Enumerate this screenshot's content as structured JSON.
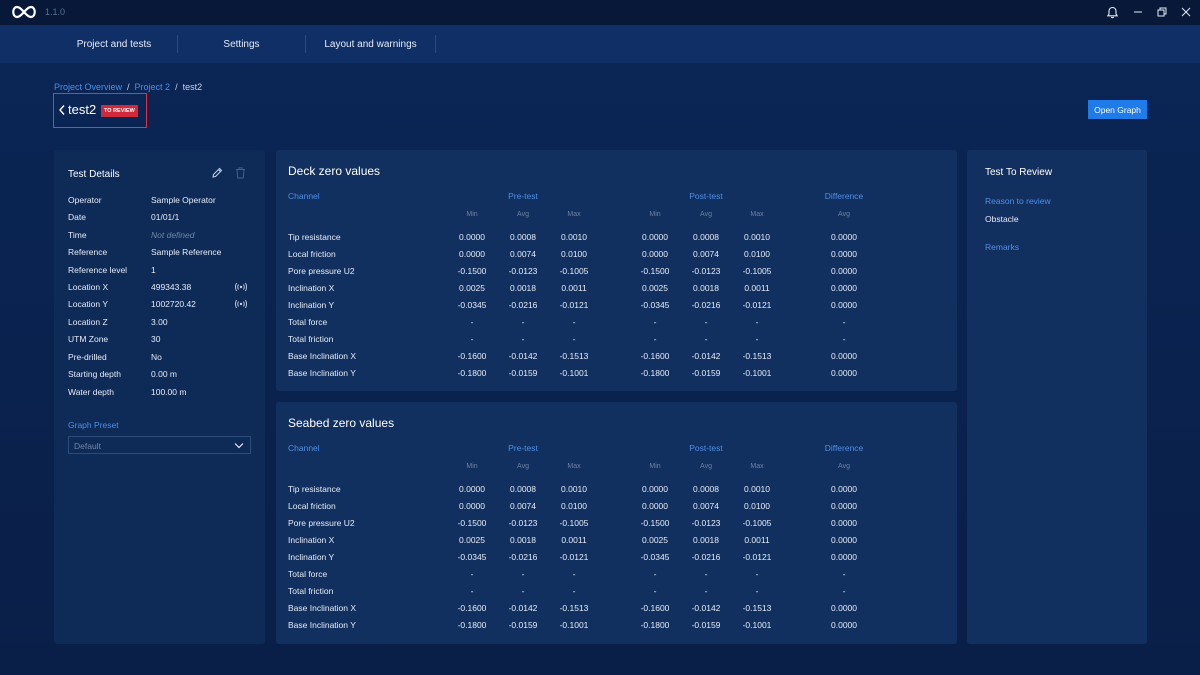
{
  "app": {
    "version": "1.1.0"
  },
  "nav": {
    "tabs": [
      {
        "label": "Project and tests"
      },
      {
        "label": "Settings"
      },
      {
        "label": "Layout and warnings"
      }
    ]
  },
  "breadcrumb": {
    "items": [
      "Project Overview",
      "Project 2"
    ],
    "separator": "/",
    "current": "test2"
  },
  "header": {
    "title": "test2",
    "badge": "TO REVIEW",
    "open_graph_label": "Open Graph"
  },
  "colors": {
    "accent": "#1f7be8",
    "badge": "#d1283a",
    "link": "#4d8fe6"
  },
  "details": {
    "heading": "Test Details",
    "rows": [
      {
        "label": "Operator",
        "value": "Sample Operator"
      },
      {
        "label": "Date",
        "value": "01/01/1"
      },
      {
        "label": "Time",
        "value": "Not defined"
      },
      {
        "label": "Reference",
        "value": "Sample Reference"
      },
      {
        "label": "Reference level",
        "value": "1"
      },
      {
        "label": "Location X",
        "value": "499343.38"
      },
      {
        "label": "Location Y",
        "value": "1002720.42"
      },
      {
        "label": "Location Z",
        "value": "3.00"
      },
      {
        "label": "UTM Zone",
        "value": "30"
      },
      {
        "label": "Pre-drilled",
        "value": "No"
      },
      {
        "label": "Starting depth",
        "value": "0.00 m"
      },
      {
        "label": "Water depth",
        "value": "100.00 m"
      }
    ],
    "graph_preset_label": "Graph Preset",
    "graph_preset_value": "Default"
  },
  "table_headers": {
    "channel": "Channel",
    "pre": "Pre-test",
    "post": "Post-test",
    "diff": "Difference",
    "min": "Min",
    "avg": "Avg",
    "max": "Max"
  },
  "deck": {
    "title": "Deck zero values",
    "rows": [
      {
        "channel": "Tip resistance",
        "vals": [
          "0.0000",
          "0.0008",
          "0.0010",
          "0.0000",
          "0.0008",
          "0.0010",
          "0.0000"
        ]
      },
      {
        "channel": "Local friction",
        "vals": [
          "0.0000",
          "0.0074",
          "0.0100",
          "0.0000",
          "0.0074",
          "0.0100",
          "0.0000"
        ]
      },
      {
        "channel": "Pore pressure U2",
        "vals": [
          "-0.1500",
          "-0.0123",
          "-0.1005",
          "-0.1500",
          "-0.0123",
          "-0.1005",
          "0.0000"
        ]
      },
      {
        "channel": "Inclination X",
        "vals": [
          "0.0025",
          "0.0018",
          "0.0011",
          "0.0025",
          "0.0018",
          "0.0011",
          "0.0000"
        ]
      },
      {
        "channel": "Inclination Y",
        "vals": [
          "-0.0345",
          "-0.0216",
          "-0.0121",
          "-0.0345",
          "-0.0216",
          "-0.0121",
          "0.0000"
        ]
      },
      {
        "channel": "Total force",
        "vals": [
          "-",
          "-",
          "-",
          "-",
          "-",
          "-",
          "-"
        ]
      },
      {
        "channel": "Total friction",
        "vals": [
          "-",
          "-",
          "-",
          "-",
          "-",
          "-",
          "-"
        ]
      },
      {
        "channel": "Base Inclination X",
        "vals": [
          "-0.1600",
          "-0.0142",
          "-0.1513",
          "-0.1600",
          "-0.0142",
          "-0.1513",
          "0.0000"
        ]
      },
      {
        "channel": "Base Inclination Y",
        "vals": [
          "-0.1800",
          "-0.0159",
          "-0.1001",
          "-0.1800",
          "-0.0159",
          "-0.1001",
          "0.0000"
        ]
      }
    ]
  },
  "seabed": {
    "title": "Seabed zero values",
    "rows": [
      {
        "channel": "Tip resistance",
        "vals": [
          "0.0000",
          "0.0008",
          "0.0010",
          "0.0000",
          "0.0008",
          "0.0010",
          "0.0000"
        ]
      },
      {
        "channel": "Local friction",
        "vals": [
          "0.0000",
          "0.0074",
          "0.0100",
          "0.0000",
          "0.0074",
          "0.0100",
          "0.0000"
        ]
      },
      {
        "channel": "Pore pressure U2",
        "vals": [
          "-0.1500",
          "-0.0123",
          "-0.1005",
          "-0.1500",
          "-0.0123",
          "-0.1005",
          "0.0000"
        ]
      },
      {
        "channel": "Inclination X",
        "vals": [
          "0.0025",
          "0.0018",
          "0.0011",
          "0.0025",
          "0.0018",
          "0.0011",
          "0.0000"
        ]
      },
      {
        "channel": "Inclination Y",
        "vals": [
          "-0.0345",
          "-0.0216",
          "-0.0121",
          "-0.0345",
          "-0.0216",
          "-0.0121",
          "0.0000"
        ]
      },
      {
        "channel": "Total force",
        "vals": [
          "-",
          "-",
          "-",
          "-",
          "-",
          "-",
          "-"
        ]
      },
      {
        "channel": "Total friction",
        "vals": [
          "-",
          "-",
          "-",
          "-",
          "-",
          "-",
          "-"
        ]
      },
      {
        "channel": "Base Inclination X",
        "vals": [
          "-0.1600",
          "-0.0142",
          "-0.1513",
          "-0.1600",
          "-0.0142",
          "-0.1513",
          "0.0000"
        ]
      },
      {
        "channel": "Base Inclination Y",
        "vals": [
          "-0.1800",
          "-0.0159",
          "-0.1001",
          "-0.1800",
          "-0.0159",
          "-0.1001",
          "0.0000"
        ]
      }
    ]
  },
  "review": {
    "heading": "Test To Review",
    "reason_label": "Reason to review",
    "reason_value": "Obstacle",
    "remarks_label": "Remarks"
  }
}
